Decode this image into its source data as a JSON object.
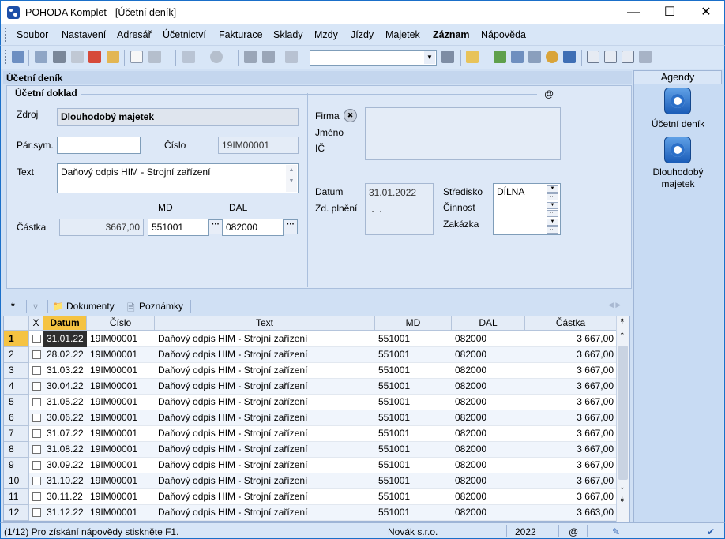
{
  "window": {
    "title": "POHODA Komplet - [Účetní deník]"
  },
  "menu": [
    "Soubor",
    "Nastavení",
    "Adresář",
    "Účetnictví",
    "Fakturace",
    "Sklady",
    "Mzdy",
    "Jízdy",
    "Majetek",
    "Záznam",
    "Nápověda"
  ],
  "section": {
    "header": "Účetní deník",
    "legend": "Účetní doklad",
    "at": "@"
  },
  "form": {
    "zdroj_label": "Zdroj",
    "zdroj_value": "Dlouhodobý majetek",
    "parsym_label": "Pár.sym.",
    "parsym_value": "",
    "cislo_label": "Číslo",
    "cislo_value": "19IM00001",
    "text_label": "Text",
    "text_value": "Daňový odpis HIM - Strojní zařízení",
    "md_label": "MD",
    "dal_label": "DAL",
    "castka_label": "Částka",
    "castka_value": "3667,00",
    "md_value": "551001",
    "dal_value": "082000",
    "firma_label": "Firma",
    "jmeno_label": "Jméno",
    "ic_label": "IČ",
    "datum_label": "Datum",
    "datum_value": "31.01.2022",
    "zdplneni_label": "Zd. plnění",
    "zdplneni_value": " .  .",
    "stredisko_label": "Středisko",
    "stredisko_value": "DÍLNA",
    "cinnost_label": "Činnost",
    "zakazka_label": "Zakázka"
  },
  "agenda": {
    "title": "Agendy",
    "items": [
      "Účetní deník",
      "Dlouhodobý majetek"
    ]
  },
  "tabs": {
    "star": "*",
    "dokumenty": "Dokumenty",
    "poznamky": "Poznámky"
  },
  "grid": {
    "columns": [
      "X",
      "Datum",
      "Číslo",
      "Text",
      "MD",
      "DAL",
      "Částka"
    ],
    "rows": [
      {
        "n": "1",
        "datum": "31.01.22",
        "cislo": "19IM00001",
        "text": "Daňový odpis HIM - Strojní zařízení",
        "md": "551001",
        "dal": "082000",
        "castka": "3 667,00"
      },
      {
        "n": "2",
        "datum": "28.02.22",
        "cislo": "19IM00001",
        "text": "Daňový odpis HIM - Strojní zařízení",
        "md": "551001",
        "dal": "082000",
        "castka": "3 667,00"
      },
      {
        "n": "3",
        "datum": "31.03.22",
        "cislo": "19IM00001",
        "text": "Daňový odpis HIM - Strojní zařízení",
        "md": "551001",
        "dal": "082000",
        "castka": "3 667,00"
      },
      {
        "n": "4",
        "datum": "30.04.22",
        "cislo": "19IM00001",
        "text": "Daňový odpis HIM - Strojní zařízení",
        "md": "551001",
        "dal": "082000",
        "castka": "3 667,00"
      },
      {
        "n": "5",
        "datum": "31.05.22",
        "cislo": "19IM00001",
        "text": "Daňový odpis HIM - Strojní zařízení",
        "md": "551001",
        "dal": "082000",
        "castka": "3 667,00"
      },
      {
        "n": "6",
        "datum": "30.06.22",
        "cislo": "19IM00001",
        "text": "Daňový odpis HIM - Strojní zařízení",
        "md": "551001",
        "dal": "082000",
        "castka": "3 667,00"
      },
      {
        "n": "7",
        "datum": "31.07.22",
        "cislo": "19IM00001",
        "text": "Daňový odpis HIM - Strojní zařízení",
        "md": "551001",
        "dal": "082000",
        "castka": "3 667,00"
      },
      {
        "n": "8",
        "datum": "31.08.22",
        "cislo": "19IM00001",
        "text": "Daňový odpis HIM - Strojní zařízení",
        "md": "551001",
        "dal": "082000",
        "castka": "3 667,00"
      },
      {
        "n": "9",
        "datum": "30.09.22",
        "cislo": "19IM00001",
        "text": "Daňový odpis HIM - Strojní zařízení",
        "md": "551001",
        "dal": "082000",
        "castka": "3 667,00"
      },
      {
        "n": "10",
        "datum": "31.10.22",
        "cislo": "19IM00001",
        "text": "Daňový odpis HIM - Strojní zařízení",
        "md": "551001",
        "dal": "082000",
        "castka": "3 667,00"
      },
      {
        "n": "11",
        "datum": "30.11.22",
        "cislo": "19IM00001",
        "text": "Daňový odpis HIM - Strojní zařízení",
        "md": "551001",
        "dal": "082000",
        "castka": "3 667,00"
      },
      {
        "n": "12",
        "datum": "31.12.22",
        "cislo": "19IM00001",
        "text": "Daňový odpis HIM - Strojní zařízení",
        "md": "551001",
        "dal": "082000",
        "castka": "3 663,00"
      }
    ]
  },
  "status": {
    "help": "(1/12) Pro získání nápovědy stiskněte F1.",
    "company": "Novák s.r.o.",
    "year": "2022",
    "at": "@"
  },
  "colors": {
    "accent": "#1a6fc9",
    "selected_cell": "#f5c342",
    "row_alt": "#f0f5fc"
  }
}
